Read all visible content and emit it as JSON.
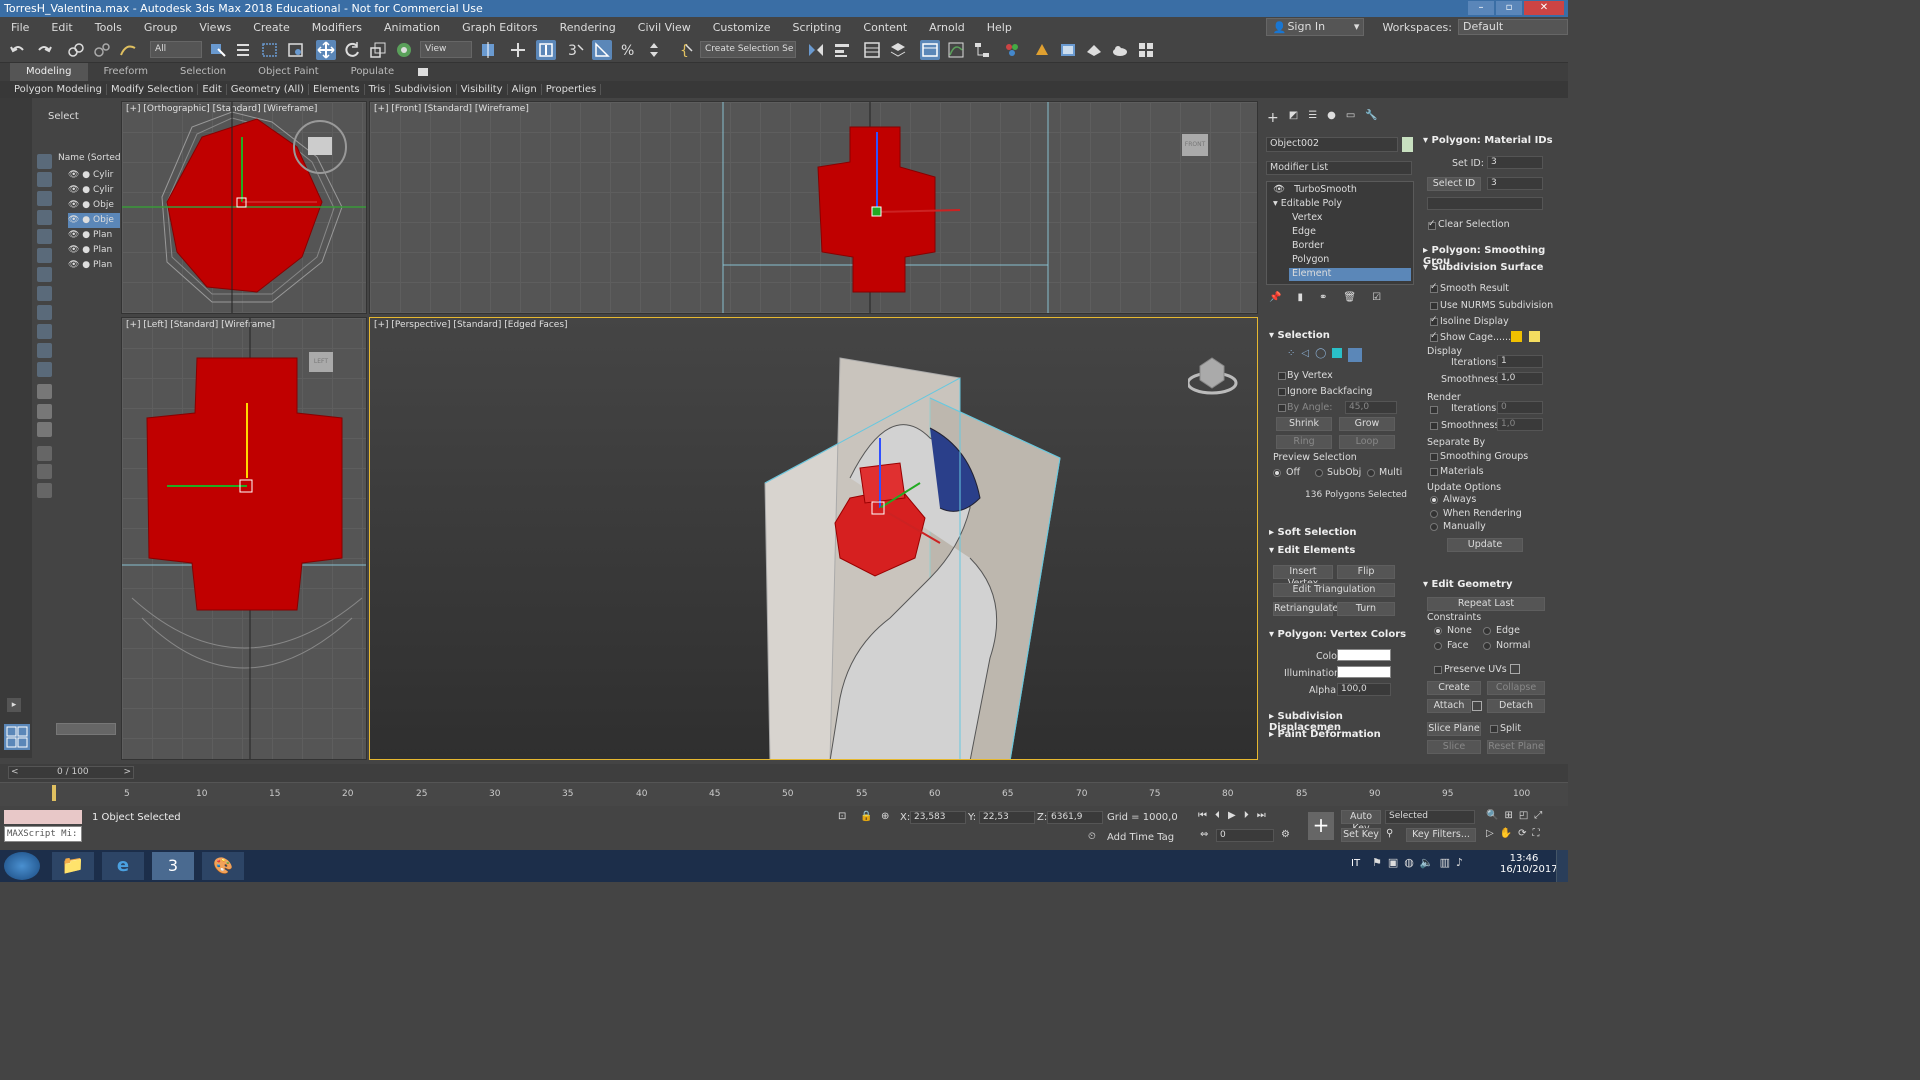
{
  "title": "TorresH_Valentina.max - Autodesk 3ds Max 2018 Educational - Not for Commercial Use",
  "menu": [
    "File",
    "Edit",
    "Tools",
    "Group",
    "Views",
    "Create",
    "Modifiers",
    "Animation",
    "Graph Editors",
    "Rendering",
    "Civil View",
    "Customize",
    "Scripting",
    "Content",
    "Arnold",
    "Help"
  ],
  "account": {
    "signin": "Sign In",
    "workspaces_label": "Workspaces:",
    "workspace": "Default"
  },
  "toolbar": {
    "filter": "All",
    "view": "View",
    "selection_set": "Create Selection Se"
  },
  "ribbon": {
    "tabs": [
      "Modeling",
      "Freeform",
      "Selection",
      "Object Paint",
      "Populate"
    ],
    "sub": [
      "Polygon Modeling",
      "Modify Selection",
      "Edit",
      "Geometry (All)",
      "Elements",
      "Tris",
      "Subdivision",
      "Visibility",
      "Align",
      "Properties"
    ]
  },
  "scene": {
    "select_label": "Select",
    "header": "Name (Sorted A",
    "items": [
      "Cylir",
      "Cylir",
      "Obje",
      "Obje",
      "Plan",
      "Plan",
      "Plan"
    ]
  },
  "viewports": {
    "top_left": "[+] [Orthographic] [Standard] [Wireframe]",
    "front": "[+] [Front] [Standard] [Wireframe]",
    "left": "[+] [Left] [Standard] [Wireframe]",
    "perspective": "[+] [Perspective] [Standard] [Edged Faces]",
    "viewcube_front": "FRONT",
    "viewcube_left": "LEFT"
  },
  "command_panel": {
    "object_name": "Object002",
    "modifier_list": "Modifier List",
    "stack": [
      "TurboSmooth",
      "Editable Poly",
      "Vertex",
      "Edge",
      "Border",
      "Polygon",
      "Element"
    ],
    "selection": {
      "title": "Selection",
      "by_vertex": "By Vertex",
      "ignore_backfacing": "Ignore Backfacing",
      "by_angle": "By Angle:",
      "by_angle_value": "45,0",
      "shrink": "Shrink",
      "grow": "Grow",
      "ring": "Ring",
      "loop": "Loop",
      "preview": "Preview Selection",
      "off": "Off",
      "subobj": "SubObj",
      "multi": "Multi",
      "status": "136 Polygons Selected"
    },
    "soft_selection": "Soft Selection",
    "edit_elements": {
      "title": "Edit Elements",
      "insert_vertex": "Insert Vertex",
      "flip": "Flip",
      "edit_triangulation": "Edit Triangulation",
      "retriangulate": "Retriangulate",
      "turn": "Turn"
    },
    "vertex_colors": {
      "title": "Polygon: Vertex Colors",
      "color": "Color:",
      "illumination": "Illumination:",
      "alpha": "Alpha:",
      "alpha_value": "100,0"
    },
    "subdiv_displacement": "Subdivision Displacemen",
    "paint_deformation": "Paint Deformation"
  },
  "right_panel": {
    "material_ids": {
      "title": "Polygon: Material IDs",
      "set_id": "Set ID:",
      "set_id_value": "3",
      "select_id": "Select ID",
      "select_id_value": "3",
      "clear_selection": "Clear Selection"
    },
    "smoothing_groups": "Polygon: Smoothing Grou",
    "subdivision_surface": {
      "title": "Subdivision Surface",
      "smooth_result": "Smooth Result",
      "use_nurms": "Use NURMS Subdivision",
      "isoline": "Isoline Display",
      "show_cage": "Show Cage......",
      "display": "Display",
      "iterations": "Iterations:",
      "iterations_value": "1",
      "smoothness": "Smoothness:",
      "smoothness_value": "1,0",
      "render": "Render",
      "r_iterations_value": "0",
      "r_smoothness_value": "1,0",
      "separate_by": "Separate By",
      "smoothing_groups": "Smoothing Groups",
      "materials": "Materials",
      "update_options": "Update Options",
      "always": "Always",
      "when_rendering": "When Rendering",
      "manually": "Manually",
      "update": "Update"
    },
    "edit_geometry": {
      "title": "Edit Geometry",
      "repeat_last": "Repeat Last",
      "constraints": "Constraints",
      "none": "None",
      "edge": "Edge",
      "face": "Face",
      "normal": "Normal",
      "preserve_uvs": "Preserve UVs",
      "create": "Create",
      "collapse": "Collapse",
      "attach": "Attach",
      "detach": "Detach",
      "slice_plane": "Slice Plane",
      "split": "Split",
      "slice": "Slice",
      "reset_plane": "Reset Plane"
    }
  },
  "timeline": {
    "frame": "0 / 100",
    "ticks": [
      "5",
      "10",
      "15",
      "20",
      "25",
      "30",
      "35",
      "40",
      "45",
      "50",
      "55",
      "60",
      "65",
      "70",
      "75",
      "80",
      "85",
      "90",
      "95",
      "100"
    ]
  },
  "status": {
    "maxscript": "MAXScript Mi:",
    "selected": "1 Object Selected",
    "x_label": "X:",
    "x": "23,583",
    "y_label": "Y:",
    "y": "22,53",
    "z_label": "Z:",
    "z": "6361,9",
    "grid": "Grid = 1000,0",
    "add_time_tag": "Add Time Tag",
    "auto_key": "Auto Key",
    "set_key": "Set Key",
    "selected_mode": "Selected",
    "key_filters": "Key Filters...",
    "frame_value": "0"
  },
  "taskbar": {
    "lang": "IT",
    "time": "13:46",
    "date": "16/10/2017"
  },
  "colors": {
    "accent": "#5b87b8",
    "selection_red": "#c00000",
    "cage_yellow": "#f0c000",
    "viewport_border": "#e6b830"
  }
}
